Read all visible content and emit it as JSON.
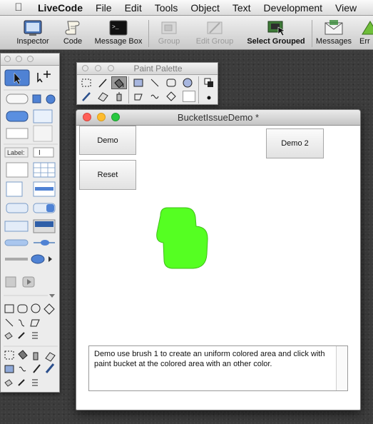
{
  "menubar": {
    "app_name": "LiveCode",
    "items": [
      "File",
      "Edit",
      "Tools",
      "Object",
      "Text",
      "Development",
      "View"
    ]
  },
  "toolbar": {
    "items": [
      {
        "label": "Inspector",
        "icon": "inspector-icon"
      },
      {
        "label": "Code",
        "icon": "script-scroll-icon"
      },
      {
        "label": "Message Box",
        "icon": "terminal-icon"
      },
      {
        "label": "Group",
        "icon": "group-icon",
        "disabled": true
      },
      {
        "label": "Edit Group",
        "icon": "edit-group-icon",
        "disabled": true
      },
      {
        "label": "Select Grouped",
        "icon": "select-grouped-icon"
      },
      {
        "label": "Messages",
        "icon": "envelope-icon"
      },
      {
        "label": "Err",
        "icon": "error-icon"
      }
    ]
  },
  "tools_palette": {
    "label_field_text": "Label:",
    "text_cursor": "I"
  },
  "paint_palette": {
    "title": "Paint Palette",
    "selected_tool": "bucket"
  },
  "document": {
    "title": "BucketIssueDemo *",
    "buttons": {
      "demo": "Demo",
      "reset": "Reset",
      "demo2": "Demo 2"
    },
    "description": "Demo use brush 1 to create an uniform colored area and click with paint bucket at the colored area with an other color.",
    "blob_color": "#55ff22"
  },
  "colors": {
    "close_light": "#ff5f57",
    "minimize_light": "#febc2e",
    "zoom_light": "#28c840"
  }
}
